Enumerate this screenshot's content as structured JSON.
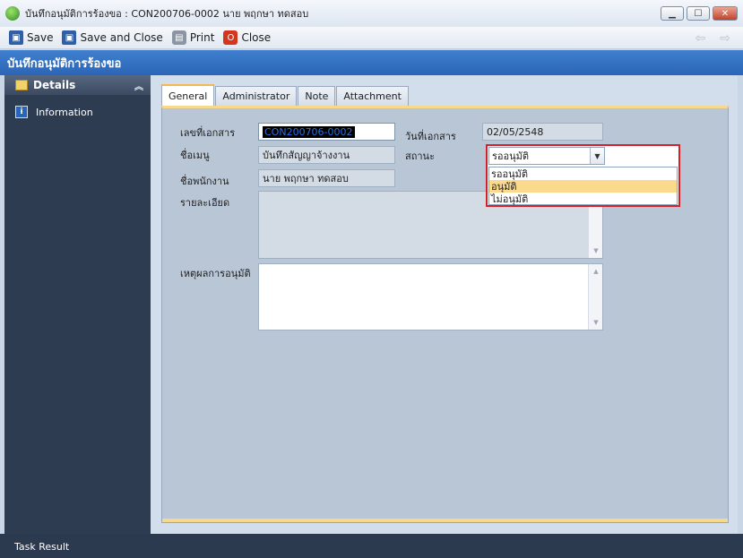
{
  "window": {
    "title": "บันทึกอนุมัติการร้องขอ : CON200706-0002 นาย พฤกษา ทดสอบ",
    "controls": [
      "minimize",
      "maximize",
      "close"
    ]
  },
  "toolbar": {
    "save_label": "Save",
    "save_close_label": "Save and Close",
    "print_label": "Print",
    "close_label": "Close"
  },
  "header": {
    "title": "บันทึกอนุมัติการร้องขอ"
  },
  "sidebar": {
    "section_label": "Details",
    "items": [
      {
        "label": "Information"
      }
    ]
  },
  "tabs": [
    {
      "label": "General",
      "active": true
    },
    {
      "label": "Administrator",
      "active": false
    },
    {
      "label": "Note",
      "active": false
    },
    {
      "label": "Attachment",
      "active": false
    }
  ],
  "form": {
    "doc_no_label": "เลขที่เอกสาร",
    "doc_no_value": "CON200706-0002",
    "doc_date_label": "วันที่เอกสาร",
    "doc_date_value": "02/05/2548",
    "menu_name_label": "ชื่อเมนู",
    "menu_name_value": "บันทึกสัญญาจ้างงาน",
    "status_label": "สถานะ",
    "status_value": "รออนุมัติ",
    "status_options": [
      "รออนุมัติ",
      "อนุมัติ",
      "ไม่อนุมัติ"
    ],
    "status_highlighted": "อนุมัติ",
    "employee_label": "ชื่อพนักงาน",
    "employee_value": "นาย พฤกษา ทดสอบ",
    "detail_label": "รายละเอียด",
    "detail_value": "",
    "reason_label": "เหตุผลการอนุมัติ",
    "reason_value": ""
  },
  "status_bar": {
    "label": "Task Result"
  },
  "colors": {
    "header_band": "#2b65b7",
    "sidebar": "#2e3c52",
    "dropdown_highlight": "#fbd98d",
    "dropdown_border": "#d4202a",
    "tab_accent": "#f3b950"
  }
}
